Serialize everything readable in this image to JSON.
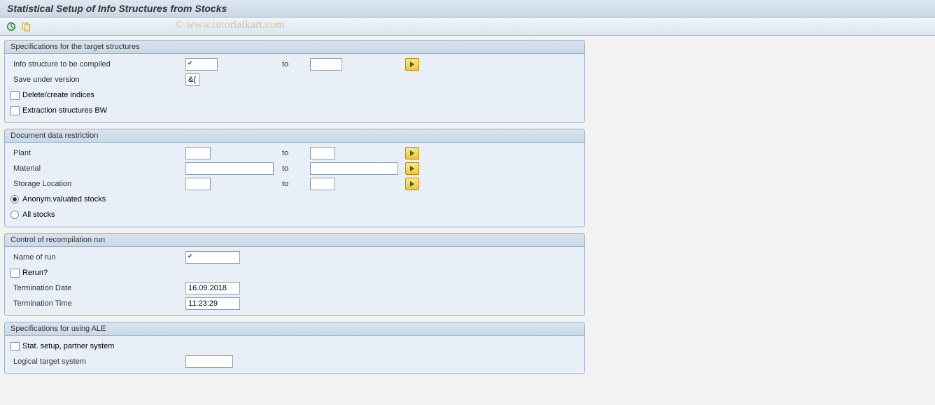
{
  "title": "Statistical Setup of Info Structures from Stocks",
  "watermark": "© www.tutorialkart.com",
  "group1": {
    "header": "Specifications for the target structures",
    "info_struct_label": "Info structure to be compiled",
    "info_struct_from": "",
    "to_label": "to",
    "info_struct_to": "",
    "save_ver_label": "Save under version",
    "save_ver_value": "&(",
    "delete_indices_label": "Delete/create indices",
    "extraction_bw_label": "Extraction structures BW"
  },
  "group2": {
    "header": "Document data restriction",
    "plant_label": "Plant",
    "plant_from": "",
    "plant_to": "",
    "material_label": "Material",
    "material_from": "",
    "material_to": "",
    "storage_label": "Storage Location",
    "storage_from": "",
    "storage_to": "",
    "radio_anon_label": "Anonym.valuated stocks",
    "radio_all_label": "All stocks",
    "to_label": "to"
  },
  "group3": {
    "header": "Control of recompilation run",
    "name_label": "Name of run",
    "name_value": "",
    "rerun_label": "Rerun?",
    "term_date_label": "Termination Date",
    "term_date_value": "16.09.2018",
    "term_time_label": "Termination Time",
    "term_time_value": "11:23:29"
  },
  "group4": {
    "header": "Specifications for using ALE",
    "stat_setup_label": "Stat. setup, partner system",
    "logical_target_label": "Logical target system",
    "logical_target_value": ""
  }
}
